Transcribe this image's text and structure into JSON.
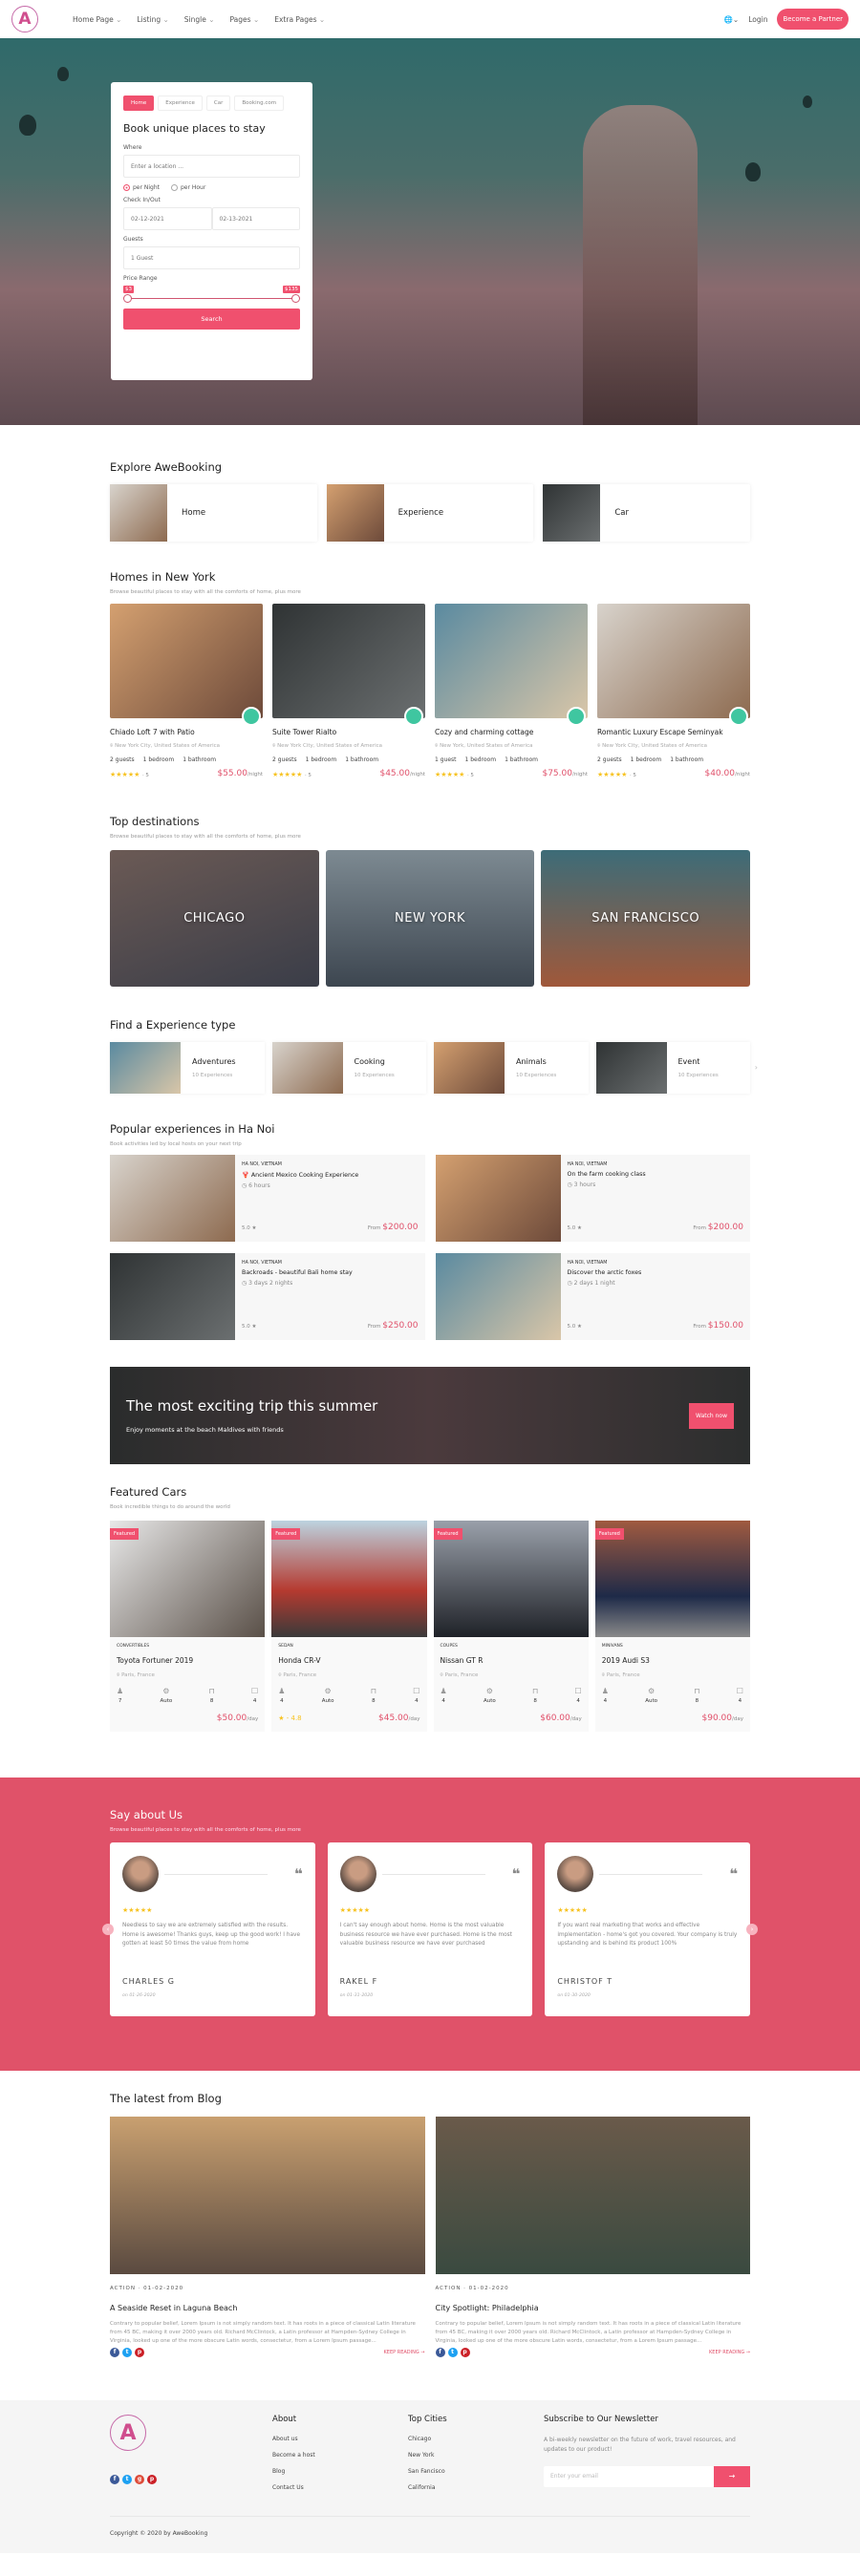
{
  "brand": {
    "accent": "#f0506e",
    "section_pink": "#e05269",
    "logo_letter": "A"
  },
  "header": {
    "nav": [
      "Home Page",
      "Listing",
      "Single",
      "Pages",
      "Extra Pages"
    ],
    "language_icon": "globe-icon",
    "login": "Login",
    "partner": "Become a Partner"
  },
  "search": {
    "tabs": [
      "Home",
      "Experience",
      "Car",
      "Booking.com"
    ],
    "active_tab": "Home",
    "title": "Book unique places to stay",
    "where_label": "Where",
    "where_placeholder": "Enter a location ...",
    "rate_options": [
      "per Night",
      "per Hour"
    ],
    "rate_selected": "per Night",
    "checkin_label": "Check In/Out",
    "checkin": "02-12-2021",
    "checkout": "02-13-2021",
    "guests_label": "Guests",
    "guests": "1 Guest",
    "price_label": "Price Range",
    "price_min": "$3",
    "price_max": "$135",
    "submit": "Search"
  },
  "explore": {
    "title": "Explore AweBooking",
    "items": [
      {
        "label": "Home"
      },
      {
        "label": "Experience"
      },
      {
        "label": "Car"
      }
    ]
  },
  "homes": {
    "title": "Homes in New York",
    "subtitle": "Browse beautiful places to stay with all the comforts of home, plus more",
    "items": [
      {
        "title": "Chiado Loft 7 with Patio",
        "location": "New York City, United States of America",
        "guests": "2 guests",
        "bedrooms": "1 bedroom",
        "bathrooms": "1 bathroom",
        "stars": "★★★★★",
        "rating": "· 5",
        "price": "$55.00",
        "unit": "/night"
      },
      {
        "title": "Suite Tower Rialto",
        "location": "New York City, United States of America",
        "guests": "2 guests",
        "bedrooms": "1 bedroom",
        "bathrooms": "1 bathroom",
        "stars": "★★★★★",
        "rating": "· 5",
        "price": "$45.00",
        "unit": "/night"
      },
      {
        "title": "Cozy and charming cottage",
        "location": "New York, United States of America",
        "guests": "1 guest",
        "bedrooms": "1 bedroom",
        "bathrooms": "1 bathroom",
        "stars": "★★★★★",
        "rating": "· 5",
        "price": "$75.00",
        "unit": "/night"
      },
      {
        "title": "Romantic Luxury Escape Seminyak",
        "location": "New York City, United States of America",
        "guests": "2 guests",
        "bedrooms": "1 bedroom",
        "bathrooms": "1 bathroom",
        "stars": "★★★★★",
        "rating": "· 5",
        "price": "$40.00",
        "unit": "/night"
      }
    ]
  },
  "destinations": {
    "title": "Top destinations",
    "subtitle": "Browse beautiful places to stay with all the comforts of home, plus more",
    "items": [
      {
        "name": "CHICAGO"
      },
      {
        "name": "NEW YORK"
      },
      {
        "name": "SAN FRANCISCO"
      }
    ]
  },
  "experience_types": {
    "title": "Find a Experience type",
    "items": [
      {
        "name": "Adventures",
        "count": "10 Experiences"
      },
      {
        "name": "Cooking",
        "count": "10 Experiences"
      },
      {
        "name": "Animals",
        "count": "10 Experiences"
      },
      {
        "name": "Event",
        "count": "10 Experiences"
      }
    ]
  },
  "popular": {
    "title": "Popular experiences in Ha Noi",
    "subtitle": "Book activities led by local hosts on your next trip",
    "items": [
      {
        "location": "HA NOI, VIETNAM",
        "title": "🦞 Ancient Mexico Cooking Experience",
        "duration": "6 hours",
        "rating": "5.0 ★",
        "from": "From",
        "price": "$200.00"
      },
      {
        "location": "HA NOI, VIETNAM",
        "title": "On the farm cooking class",
        "duration": "3 hours",
        "rating": "5.0 ★",
        "from": "From",
        "price": "$200.00"
      },
      {
        "location": "HA NOI, VIETNAM",
        "title": "Backroads - beautiful Bali home stay",
        "duration": "3 days 2 nights",
        "rating": "5.0 ★",
        "from": "From",
        "price": "$250.00"
      },
      {
        "location": "HA NOI, VIETNAM",
        "title": "Discover the arctic foxes",
        "duration": "2 days 1 night",
        "rating": "5.0 ★",
        "from": "From",
        "price": "$150.00"
      }
    ]
  },
  "banner": {
    "title": "The most exciting trip this summer",
    "subtitle": "Enjoy moments at the beach Maldives with friends",
    "button": "Watch now"
  },
  "cars": {
    "title": "Featured Cars",
    "subtitle": "Book incredible things to do around the world",
    "items": [
      {
        "badge": "Featured",
        "category": "CONVERTIBLES",
        "title": "Toyota Fortuner 2019",
        "location": "Paris, France",
        "seats": "7",
        "transmission": "Auto",
        "doors": "8",
        "bags": "4",
        "rating": "",
        "price": "$50.00",
        "unit": "/day"
      },
      {
        "badge": "Featured",
        "category": "SEDAN",
        "title": "Honda CR-V",
        "location": "Paris, France",
        "seats": "4",
        "transmission": "Auto",
        "doors": "8",
        "bags": "4",
        "rating": "★ - 4.8",
        "price": "$45.00",
        "unit": "/day"
      },
      {
        "badge": "Featured",
        "category": "COUPES",
        "title": "Nissan GT R",
        "location": "Paris, France",
        "seats": "4",
        "transmission": "Auto",
        "doors": "8",
        "bags": "4",
        "rating": "",
        "price": "$60.00",
        "unit": "/day"
      },
      {
        "badge": "Featured",
        "category": "MINIVANS",
        "title": "2019 Audi S3",
        "location": "Paris, France",
        "seats": "4",
        "transmission": "Auto",
        "doors": "8",
        "bags": "4",
        "rating": "",
        "price": "$90.00",
        "unit": "/day"
      }
    ]
  },
  "testimonials": {
    "title": "Say about Us",
    "subtitle": "Browse beautiful places to stay with all the comforts of home, plus more",
    "items": [
      {
        "stars": "★★★★★",
        "text": "Needless to say we are extremely satisfied with the results. Home is awesome! Thanks guys, keep up the good work! I have gotten at least 50 times the value from home",
        "name": "CHARLES G",
        "date": "on 01-26-2020"
      },
      {
        "stars": "★★★★★",
        "text": "I can't say enough about home. Home is the most valuable business resource we have ever purchased. Home is the most valuable business resource we have ever purchased",
        "name": "RAKEL F",
        "date": "on 01-31-2020"
      },
      {
        "stars": "★★★★★",
        "text": "If you want real marketing that works and effective implementation - home's got you covered. Your company is truly upstanding and is behind its product 100%",
        "name": "CHRISTOF T",
        "date": "on 01-30-2020"
      }
    ]
  },
  "blog": {
    "title": "The latest from Blog",
    "items": [
      {
        "meta": "ACTION · 01-02-2020",
        "title": "A Seaside Reset in Laguna Beach",
        "excerpt": "Contrary to popular belief, Lorem Ipsum is not simply random text. It has roots in a piece of classical Latin literature from 45 BC, making it over 2000 years old. Richard McClintock, a Latin professor at Hampden-Sydney College in Virginia, looked up one of the more obscure Latin words, consectetur, from a Lorem Ipsum passage...",
        "more": "KEEP READING →"
      },
      {
        "meta": "ACTION · 01-02-2020",
        "title": "City Spotlight: Philadelphia",
        "excerpt": "Contrary to popular belief, Lorem Ipsum is not simply random text. It has roots in a piece of classical Latin literature from 45 BC, making it over 2000 years old. Richard McClintock, a Latin professor at Hampden-Sydney College in Virginia, looked up one of the more obscure Latin words, consectetur, from a Lorem Ipsum passage...",
        "more": "KEEP READING →"
      }
    ]
  },
  "footer": {
    "about_title": "About",
    "about_links": [
      "About us",
      "Become a host",
      "Blog",
      "Contact Us"
    ],
    "cities_title": "Top Cities",
    "cities": [
      "Chicago",
      "New York",
      "San Fancisco",
      "California"
    ],
    "news_title": "Subscribe to Our Newsletter",
    "news_text": "A bi-weekly newsletter on the future of work, travel resources, and updates to our product!",
    "email_placeholder": "Enter your email",
    "copyright": "Copyright © 2020 by AweBooking"
  }
}
